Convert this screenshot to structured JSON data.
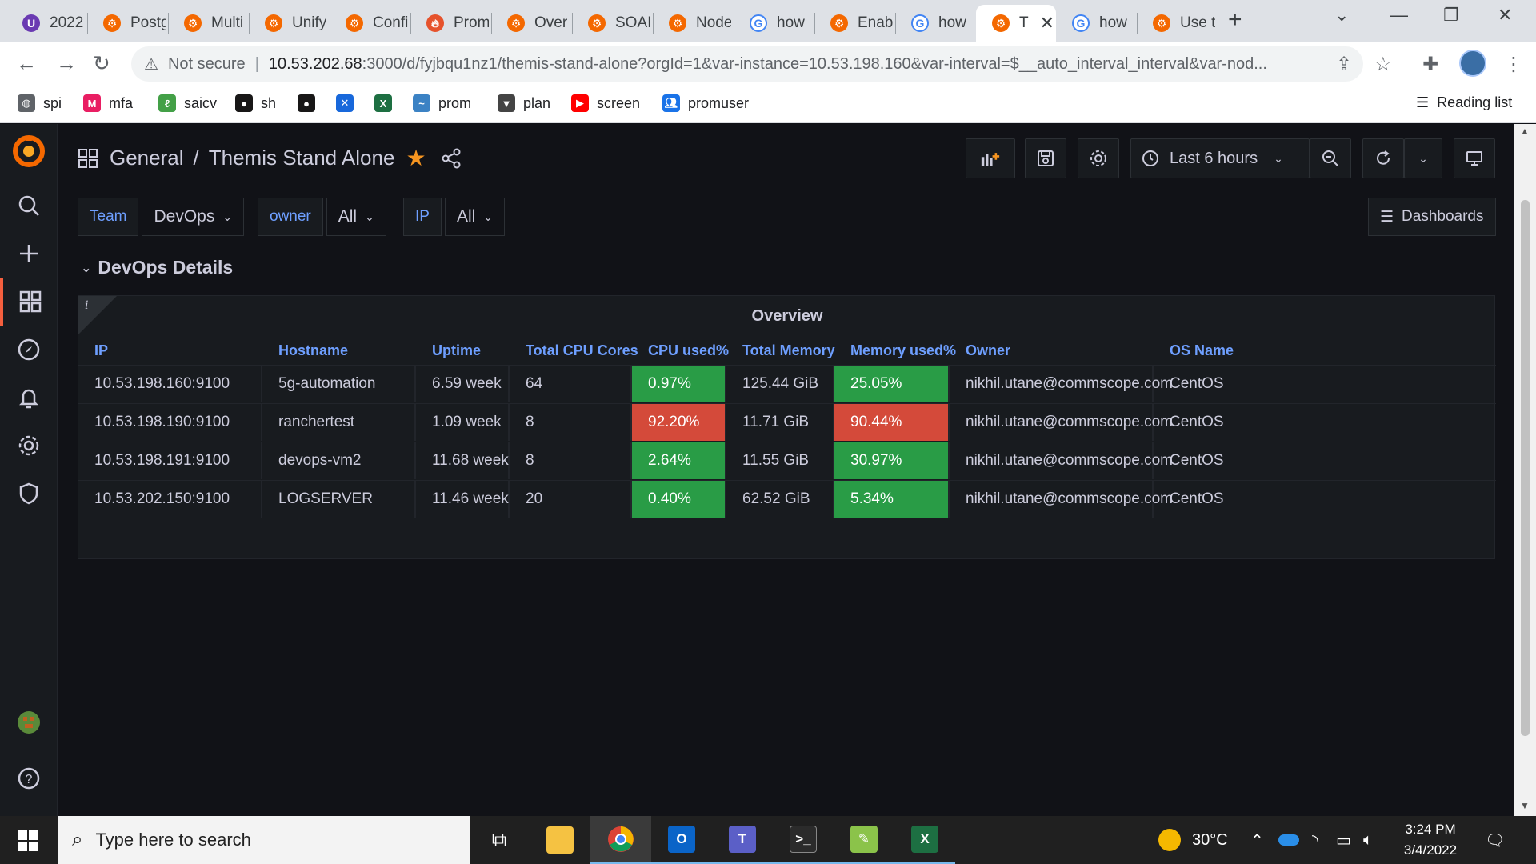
{
  "browser": {
    "tabs": [
      {
        "label": "2022",
        "icon": "purple-u-icon"
      },
      {
        "label": "Postg",
        "icon": "grafana-icon"
      },
      {
        "label": "Multi",
        "icon": "grafana-icon"
      },
      {
        "label": "Unify",
        "icon": "grafana-icon"
      },
      {
        "label": "Confi",
        "icon": "grafana-icon"
      },
      {
        "label": "Prom",
        "icon": "prometheus-icon"
      },
      {
        "label": "Over",
        "icon": "grafana-icon"
      },
      {
        "label": "SOAI",
        "icon": "grafana-icon"
      },
      {
        "label": "Node",
        "icon": "grafana-icon"
      },
      {
        "label": "how",
        "icon": "google-icon"
      },
      {
        "label": "Enab",
        "icon": "grafana-icon"
      },
      {
        "label": "how",
        "icon": "google-icon"
      },
      {
        "label": "T",
        "icon": "grafana-icon",
        "active": true
      },
      {
        "label": "how",
        "icon": "google-icon"
      },
      {
        "label": "Use t",
        "icon": "grafana-icon"
      }
    ],
    "address": {
      "security": "Not secure",
      "host": "10.53.202.68",
      "rest": ":3000/d/fyjbqu1nz1/themis-stand-alone?orgId=1&var-instance=10.53.198.160&var-interval=$__auto_interval_interval&var-nod..."
    },
    "bookmarks": [
      {
        "label": "spi",
        "icon": "globe-icon"
      },
      {
        "label": "mfa",
        "icon": "mfa-icon"
      },
      {
        "label": "saicv",
        "icon": "leaf-icon"
      },
      {
        "label": "sh",
        "icon": "github-icon"
      },
      {
        "label": "",
        "icon": "github-icon"
      },
      {
        "label": "",
        "icon": "confluence-icon"
      },
      {
        "label": "",
        "icon": "excel-icon"
      },
      {
        "label": "prom",
        "icon": "prom-bookmark-icon"
      },
      {
        "label": "plan",
        "icon": "plan-icon"
      },
      {
        "label": "screen",
        "icon": "youtube-icon"
      },
      {
        "label": "promuser",
        "icon": "people-icon"
      }
    ],
    "reading_list": "Reading list"
  },
  "dashboard": {
    "breadcrumb_folder": "General",
    "breadcrumb_sep": "/",
    "title": "Themis Stand Alone",
    "time_range": "Last 6 hours",
    "dashboards_button": "Dashboards",
    "variables": [
      {
        "label": "Team",
        "value": "DevOps"
      },
      {
        "label": "owner",
        "value": "All"
      },
      {
        "label": "IP",
        "value": "All"
      }
    ],
    "row_title": "DevOps Details",
    "panel": {
      "title": "Overview",
      "info_glyph": "i",
      "columns": [
        "IP",
        "Hostname",
        "Uptime",
        "Total CPU Cores",
        "CPU used%",
        "Total Memory",
        "Memory used%",
        "Owner",
        "OS Name"
      ],
      "rows": [
        {
          "ip": "10.53.198.160:9100",
          "hostname": "5g-automation",
          "uptime": "6.59 week",
          "cores": "64",
          "cpu": "0.97%",
          "cpu_state": "good",
          "memory": "125.44 GiB",
          "mem_used": "25.05%",
          "mem_state": "good",
          "owner": "nikhil.utane@commscope.com",
          "os": "CentOS"
        },
        {
          "ip": "10.53.198.190:9100",
          "hostname": "ranchertest",
          "uptime": "1.09 week",
          "cores": "8",
          "cpu": "92.20%",
          "cpu_state": "bad",
          "memory": "11.71 GiB",
          "mem_used": "90.44%",
          "mem_state": "bad",
          "owner": "nikhil.utane@commscope.com",
          "os": "CentOS"
        },
        {
          "ip": "10.53.198.191:9100",
          "hostname": "devops-vm2",
          "uptime": "11.68 week",
          "cores": "8",
          "cpu": "2.64%",
          "cpu_state": "good",
          "memory": "11.55 GiB",
          "mem_used": "30.97%",
          "mem_state": "good",
          "owner": "nikhil.utane@commscope.com",
          "os": "CentOS"
        },
        {
          "ip": "10.53.202.150:9100",
          "hostname": "LOGSERVER",
          "uptime": "11.46 week",
          "cores": "20",
          "cpu": "0.40%",
          "cpu_state": "good",
          "memory": "62.52 GiB",
          "mem_used": "5.34%",
          "mem_state": "good",
          "owner": "nikhil.utane@commscope.com",
          "os": "CentOS"
        }
      ]
    }
  },
  "colors": {
    "good": "#299c46",
    "bad": "#d44a3a",
    "accent": "#6e9fff",
    "star": "#f79520"
  },
  "taskbar": {
    "search_placeholder": "Type here to search",
    "weather": "30°C",
    "time": "3:24 PM",
    "date": "3/4/2022"
  }
}
